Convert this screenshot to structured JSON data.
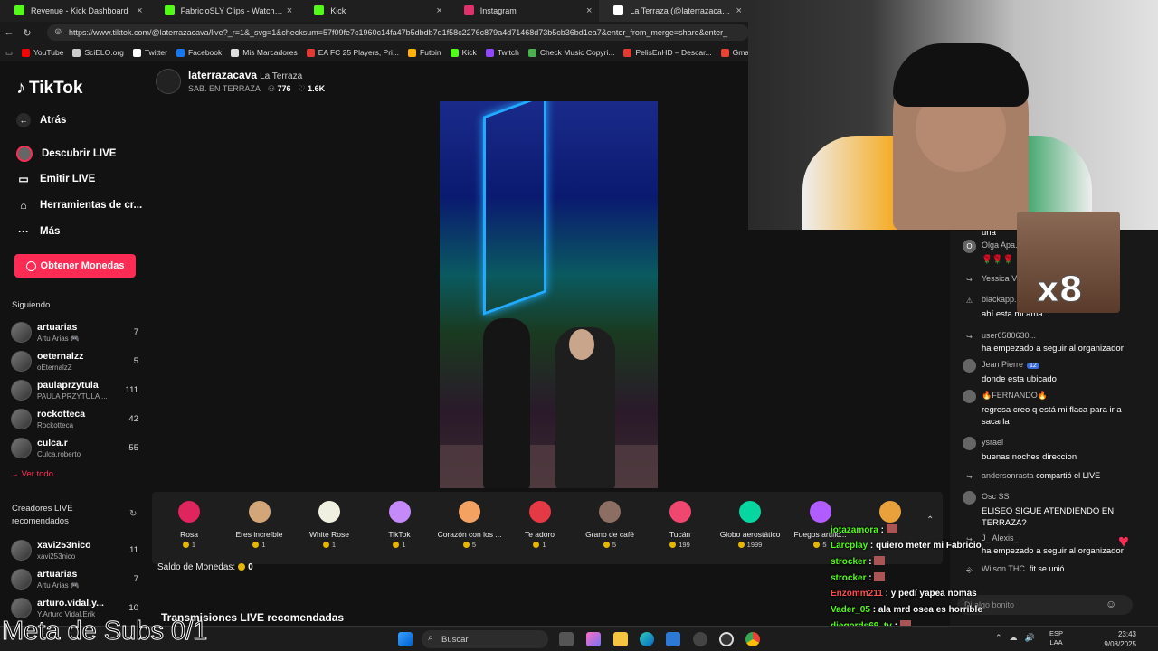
{
  "browser": {
    "tabs": [
      {
        "title": "Revenue - Kick Dashboard",
        "color": "#53fc18",
        "active": false
      },
      {
        "title": "FabricioSLY Clips - Watch Live on",
        "color": "#53fc18",
        "active": false
      },
      {
        "title": "Kick",
        "color": "#53fc18",
        "active": false
      },
      {
        "title": "Instagram",
        "color": "#e1306c",
        "active": false
      },
      {
        "title": "La Terraza (@laterrazacava)",
        "color": "#ffffff",
        "active": true
      }
    ],
    "url": "https://www.tiktok.com/@laterrazacava/live?_r=1&_svg=1&checksum=57f09fe7c1960c14fa47b5dbdb7d1f58c2276c879a4d71468d73b5cb36bd1ea7&enter_from_merge=share&enter_",
    "bookmarks": [
      {
        "label": "YouTube",
        "color": "#ff0000"
      },
      {
        "label": "SciELO.org",
        "color": "#cccccc"
      },
      {
        "label": "Twitter",
        "color": "#ffffff"
      },
      {
        "label": "Facebook",
        "color": "#1877f2"
      },
      {
        "label": "Mis Marcadores",
        "color": "#dddddd"
      },
      {
        "label": "EA FC 25 Players, Pri...",
        "color": "#e53935"
      },
      {
        "label": "Futbin",
        "color": "#ffb300"
      },
      {
        "label": "Kick",
        "color": "#53fc18"
      },
      {
        "label": "Twitch",
        "color": "#9146ff"
      },
      {
        "label": "Check Music Copyri...",
        "color": "#4caf50"
      },
      {
        "label": "PelisEnHD – Descar...",
        "color": "#e53935"
      },
      {
        "label": "Gmail",
        "color": "#ea4335"
      }
    ]
  },
  "tiktok": {
    "logo": "TikTok",
    "nav": {
      "back": "Atrás",
      "discover": "Descubrir LIVE",
      "go_live": "Emitir LIVE",
      "tools": "Herramientas de cr...",
      "more": "Más"
    },
    "coins_button": "Obtener Monedas",
    "following_title": "Siguiendo",
    "following": [
      {
        "name": "artuarias",
        "desc": "Artu Arias 🎮",
        "count": "7"
      },
      {
        "name": "oeternalzz",
        "desc": "oEternalzZ",
        "count": "5"
      },
      {
        "name": "paulaprzytula",
        "desc": "PAULA PRZYTULA ...",
        "count": "111"
      },
      {
        "name": "rockotteca",
        "desc": "Rockotteca",
        "count": "42"
      },
      {
        "name": "culca.r",
        "desc": "Culca.roberto",
        "count": "55"
      }
    ],
    "see_all": "Ver todo",
    "recommended_title": "Creadores LIVE recomendados",
    "recommended": [
      {
        "name": "xavi253nico",
        "desc": "xavi253nico",
        "count": "11"
      },
      {
        "name": "artuarias",
        "desc": "Artu Arias 🎮",
        "count": "7"
      },
      {
        "name": "arturo.vidal.y...",
        "desc": "Y.Arturo Vidal.Erik",
        "count": "10"
      }
    ],
    "host": {
      "username": "laterrazacava",
      "display": "La Terraza",
      "subtitle": "SAB. EN TERRAZA",
      "viewers": "776",
      "likes": "1.6K"
    },
    "gifts": [
      {
        "name": "Rosa",
        "price": "1",
        "color": "#e0245e"
      },
      {
        "name": "Eres increíble",
        "price": "1",
        "color": "#d2a679"
      },
      {
        "name": "White Rose",
        "price": "1",
        "color": "#f0f0e0"
      },
      {
        "name": "TikTok",
        "price": "1",
        "color": "#c58af9"
      },
      {
        "name": "Corazón con los ...",
        "price": "5",
        "color": "#f4a261"
      },
      {
        "name": "Te adoro",
        "price": "1",
        "color": "#e63946"
      },
      {
        "name": "Grano de café",
        "price": "5",
        "color": "#8d6e63"
      },
      {
        "name": "Tucán",
        "price": "199",
        "color": "#ef476f"
      },
      {
        "name": "Globo aerostático",
        "price": "1999",
        "color": "#06d6a0"
      },
      {
        "name": "Fuegos artific...",
        "price": "5",
        "color": "#b05cff"
      },
      {
        "name": "",
        "price": "",
        "color": "#e9a23b"
      }
    ],
    "balance_label": "Saldo de Monedas:",
    "balance_value": "0",
    "recommended_lives": "Transmisiones LIVE recomendadas",
    "chat": [
      {
        "user": "una",
        "text": "",
        "avatar": ""
      },
      {
        "user": "Olga Apa...",
        "text": "🌹🌹🌹",
        "avatar": "O"
      },
      {
        "user": "Yessica V...",
        "text": "",
        "avatar": "↪"
      },
      {
        "user": "blackapp...",
        "text": "ahí esta mi ama...",
        "avatar": "⚠"
      },
      {
        "user": "user6580630...",
        "text": "ha empezado a seguir al organizador",
        "avatar": "↪"
      },
      {
        "user": "Jean Pierre",
        "text": "donde esta ubicado",
        "avatar": ""
      },
      {
        "user": "🔥FERNANDO🔥",
        "text": "regresa creo q está mi flaca para ir a sacarla",
        "avatar": ""
      },
      {
        "user": "ysrael",
        "text": "buenas noches direccion",
        "avatar": ""
      },
      {
        "user": "andersonrasta",
        "text": "compartió el LIVE",
        "avatar": "↪"
      },
      {
        "user": "Osc SS",
        "text": "ELISEO SIGUE ATENDIENDO EN TERRAZA?",
        "avatar": ""
      },
      {
        "user": "J_ Alexis_",
        "text": "ha empezado a seguir al organizador",
        "avatar": "↪"
      },
      {
        "user": "Wilson THC.",
        "text": "fit se unió",
        "avatar": "⎆"
      }
    ],
    "jean_badge": "12",
    "chat_placeholder": "Di algo bonito"
  },
  "overlay": {
    "meme_text": "x8",
    "kick_chat": [
      {
        "user": "jotazamora",
        "text": "",
        "color": "green"
      },
      {
        "user": "Larcplay",
        "text": "quiero meter mi Fabricio",
        "color": "green"
      },
      {
        "user": "strocker",
        "text": "",
        "color": "green"
      },
      {
        "user": "strocker",
        "text": "",
        "color": "green"
      },
      {
        "user": "Enzomm211",
        "text": "y pedí yapea nomas",
        "color": "red"
      },
      {
        "user": "Vader_05",
        "text": "ala mrd osea es horrible",
        "color": "green"
      },
      {
        "user": "diegords69_tv",
        "text": "",
        "color": "green"
      },
      {
        "user": "diegords69_tv",
        "text": "",
        "color": "green"
      }
    ],
    "meta_subs": "Meta de Subs 0/1"
  },
  "taskbar": {
    "search": "Buscar",
    "lang_top": "ESP",
    "lang_bottom": "LAA",
    "time": "23:43",
    "date": "9/08/2025"
  }
}
